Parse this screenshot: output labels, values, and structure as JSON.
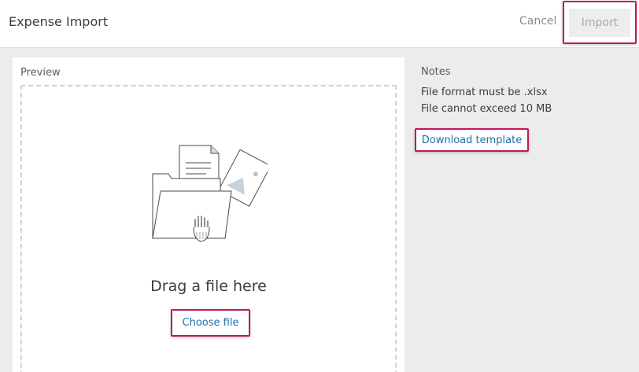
{
  "header": {
    "title": "Expense Import",
    "cancel_label": "Cancel",
    "import_label": "Import"
  },
  "preview": {
    "label": "Preview",
    "drag_text": "Drag a file here",
    "choose_file_label": "Choose file"
  },
  "notes": {
    "title": "Notes",
    "lines": [
      "File format must be .xlsx",
      "File cannot exceed 10 MB"
    ],
    "download_template_label": "Download template"
  },
  "colors": {
    "accent_highlight": "#c2185b",
    "link": "#1f6fa8",
    "background": "#ececec"
  },
  "icons": {
    "illustration": "file-upload-illustration"
  }
}
